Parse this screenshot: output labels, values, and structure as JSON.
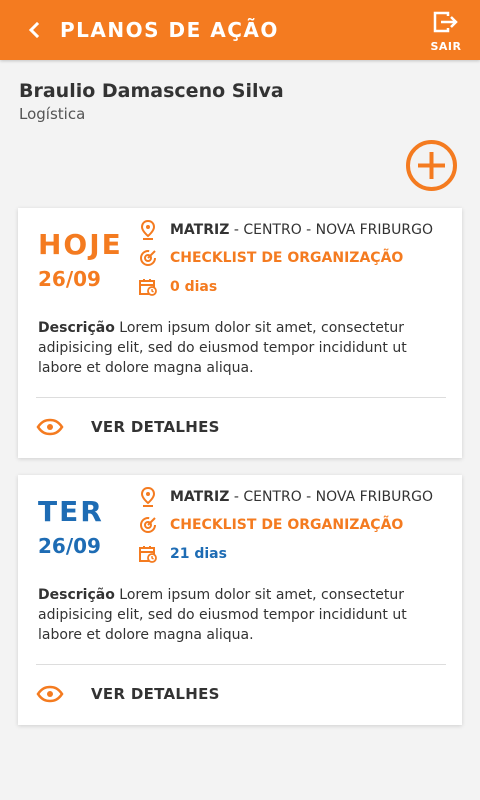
{
  "header": {
    "title": "PLANOS DE AÇÃO",
    "logout_label": "SAIR"
  },
  "user": {
    "name": "Braulio Damasceno Silva",
    "department": "Logística"
  },
  "colors": {
    "accent": "#f47b20",
    "blue": "#1e6cb4"
  },
  "cards": [
    {
      "day": "HOJE",
      "date": "26/09",
      "location_bold": "MATRIZ",
      "location_rest": " - CENTRO - NOVA FRIBURGO",
      "checklist": "CHECKLIST DE ORGANIZAÇÃO",
      "days": "0 dias",
      "desc_label": "Descrição",
      "desc_text": " Lorem ipsum dolor sit amet, consectetur adipisicing elit, sed do eiusmod tempor incididunt ut labore et dolore magna aliqua.",
      "details_label": "VER DETALHES"
    },
    {
      "day": "TER",
      "date": "26/09",
      "location_bold": "MATRIZ",
      "location_rest": " - CENTRO - NOVA FRIBURGO",
      "checklist": "CHECKLIST DE ORGANIZAÇÃO",
      "days": "21 dias",
      "desc_label": "Descrição",
      "desc_text": " Lorem ipsum dolor sit amet, consectetur adipisicing elit, sed do eiusmod tempor incididunt ut labore et dolore magna aliqua.",
      "details_label": "VER DETALHES"
    }
  ]
}
